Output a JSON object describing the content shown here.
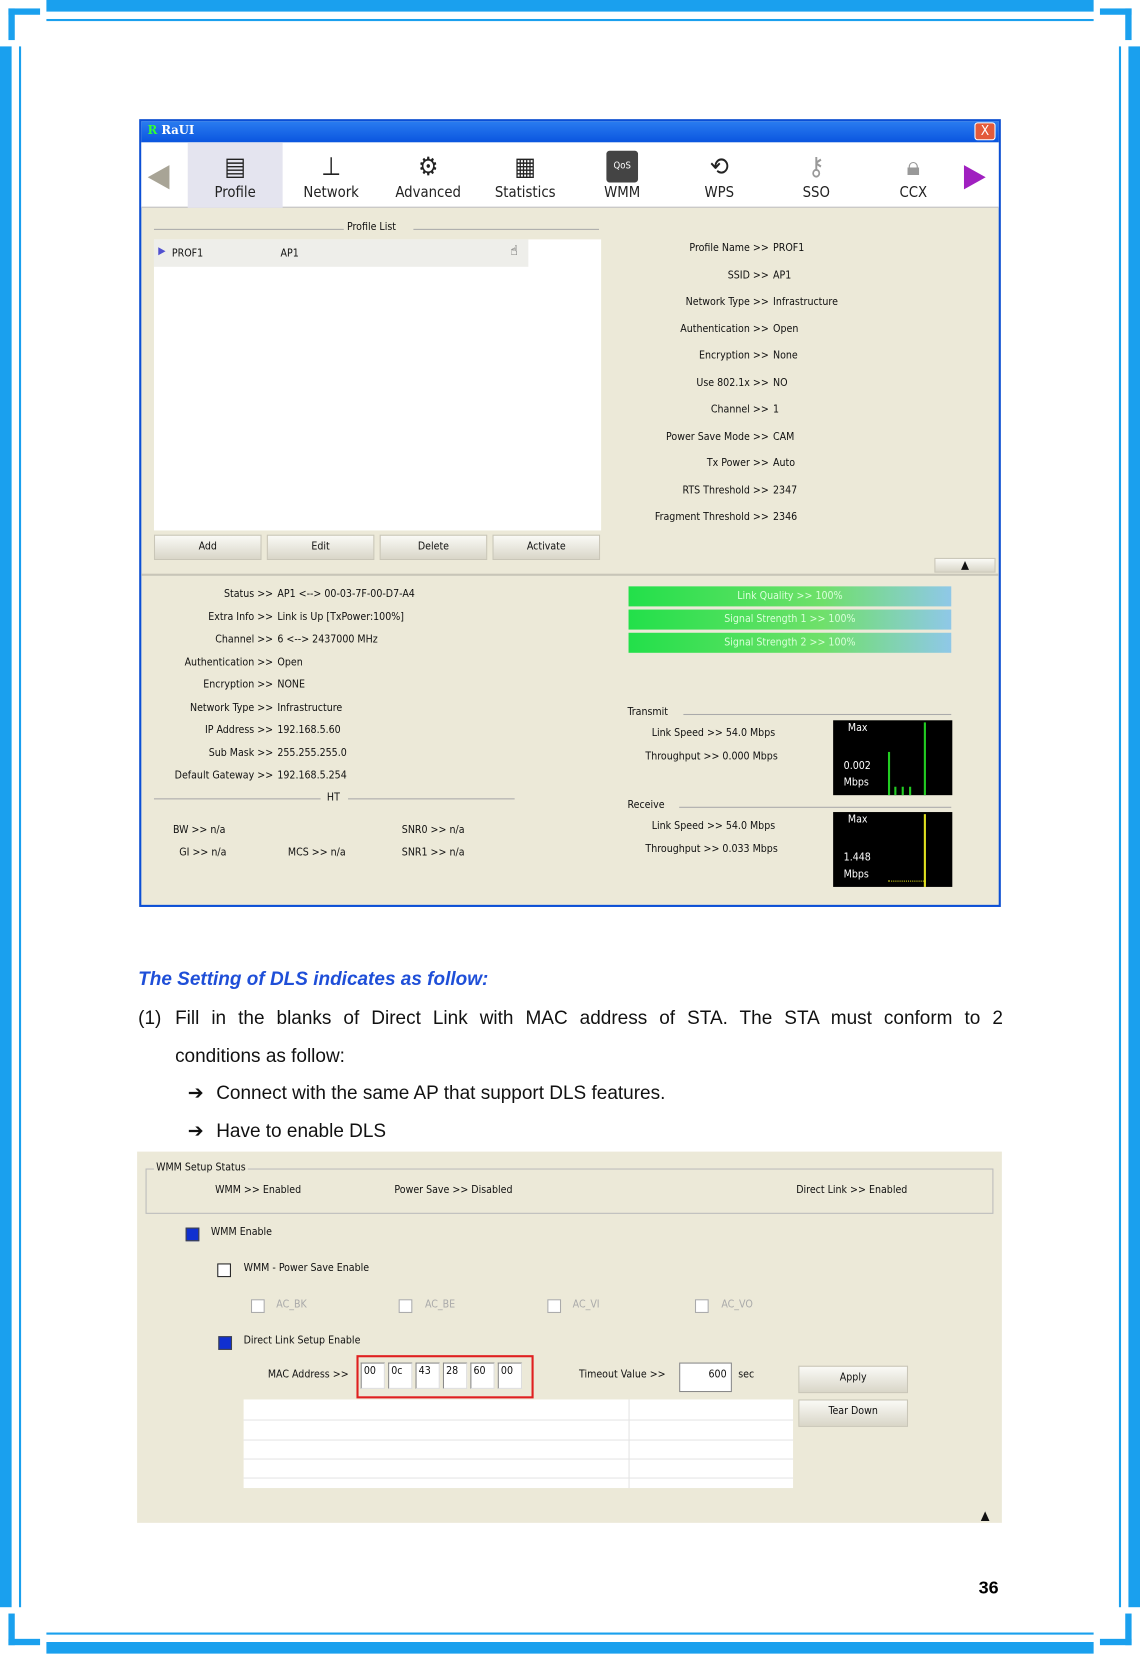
{
  "window": {
    "title": "RaUI",
    "close": "X"
  },
  "toolbar": {
    "items": [
      {
        "label": "Profile",
        "icon": "profile-icon"
      },
      {
        "label": "Network",
        "icon": "router-icon"
      },
      {
        "label": "Advanced",
        "icon": "gears-icon"
      },
      {
        "label": "Statistics",
        "icon": "statistics-icon"
      },
      {
        "label": "WMM",
        "icon": "qos-icon"
      },
      {
        "label": "WPS",
        "icon": "wps-icon"
      },
      {
        "label": "SSO",
        "icon": "sso-icon"
      },
      {
        "label": "CCX",
        "icon": "ccx-icon"
      }
    ]
  },
  "profile_list": {
    "title": "Profile List",
    "rows": [
      {
        "name": "PROF1",
        "ssid": "AP1"
      }
    ],
    "buttons": [
      "Add",
      "Edit",
      "Delete",
      "Activate"
    ]
  },
  "profile_details": [
    [
      "Profile Name >>",
      "PROF1"
    ],
    [
      "SSID >>",
      "AP1"
    ],
    [
      "Network Type >>",
      "Infrastructure"
    ],
    [
      "Authentication >>",
      "Open"
    ],
    [
      "Encryption >>",
      "None"
    ],
    [
      "Use 802.1x >>",
      "NO"
    ],
    [
      "Channel >>",
      "1"
    ],
    [
      "Power Save Mode >>",
      "CAM"
    ],
    [
      "Tx Power >>",
      "Auto"
    ],
    [
      "RTS Threshold >>",
      "2347"
    ],
    [
      "Fragment Threshold >>",
      "2346"
    ]
  ],
  "status": [
    [
      "Status >>",
      "AP1 <--> 00-03-7F-00-D7-A4"
    ],
    [
      "Extra Info >>",
      "Link is Up [TxPower:100%]"
    ],
    [
      "Channel >>",
      "6 <--> 2437000 MHz"
    ],
    [
      "Authentication >>",
      "Open"
    ],
    [
      "Encryption >>",
      "NONE"
    ],
    [
      "Network Type >>",
      "Infrastructure"
    ],
    [
      "IP Address >>",
      "192.168.5.60"
    ],
    [
      "Sub Mask >>",
      "255.255.255.0"
    ],
    [
      "Default Gateway >>",
      "192.168.5.254"
    ]
  ],
  "ht": {
    "title": "HT",
    "bw": "BW >> n/a",
    "gi": "GI >> n/a",
    "mcs": "MCS >> n/a",
    "snr0": "SNR0 >> n/a",
    "snr1": "SNR1 >> n/a"
  },
  "signal": {
    "link_quality": "Link Quality >> 100%",
    "signal1": "Signal Strength 1 >> 100%",
    "signal2": "Signal Strength 2 >> 100%",
    "link_quality_pct": 100,
    "signal1_pct": 100,
    "signal2_pct": 100
  },
  "transmit": {
    "title": "Transmit",
    "link_speed": "Link Speed >> 54.0 Mbps",
    "throughput": "Throughput >> 0.000 Mbps",
    "graph_max": "Max",
    "graph_val": "0.002",
    "graph_unit": "Mbps",
    "color": "#22cc22"
  },
  "receive": {
    "title": "Receive",
    "link_speed": "Link Speed >> 54.0 Mbps",
    "throughput": "Throughput >> 0.033 Mbps",
    "graph_max": "Max",
    "graph_val": "1.448",
    "graph_unit": "Mbps",
    "color": "#e0e020"
  },
  "doc": {
    "heading": "The Setting of DLS indicates as follow:",
    "item_num": "(1)",
    "item_text1": "Fill in the blanks of Direct Link with MAC address of STA. The STA must conform to 2",
    "item_text2": "conditions as follow:",
    "bullet1": "Connect with the same AP that support DLS features.",
    "bullet2": "Have to enable DLS",
    "page_number": "36"
  },
  "wmm": {
    "setup_status": "WMM Setup Status",
    "wmm_status": "WMM >> Enabled",
    "power_save_status": "Power Save >> Disabled",
    "direct_link_status": "Direct Link >> Enabled",
    "wmm_enable": "WMM Enable",
    "power_save_enable": "WMM - Power Save Enable",
    "ac": [
      "AC_BK",
      "AC_BE",
      "AC_VI",
      "AC_VO"
    ],
    "dls_enable": "Direct Link Setup Enable",
    "mac_label": "MAC Address >>",
    "mac": [
      "00",
      "0c",
      "43",
      "28",
      "60",
      "00"
    ],
    "timeout_label": "Timeout Value >>",
    "timeout": "600",
    "timeout_unit": "sec",
    "apply": "Apply",
    "tear_down": "Tear Down",
    "wmm_checked": true,
    "power_save_checked": false,
    "dls_checked": true
  }
}
